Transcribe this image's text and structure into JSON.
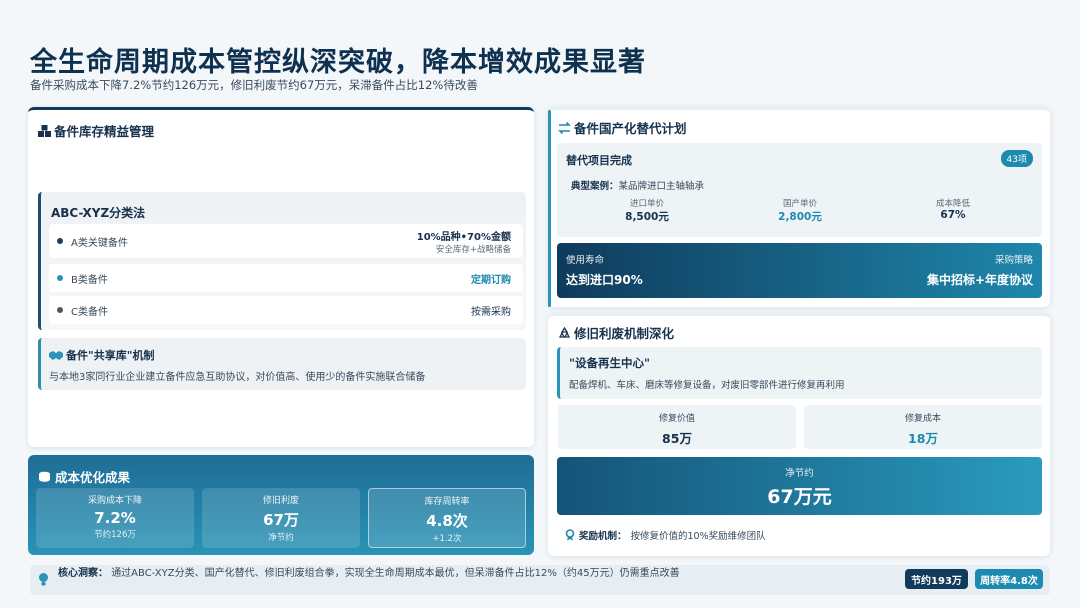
{
  "header": {
    "title": "全生命周期成本管控纵深突破，降本增效成果显著",
    "subtitle": "备件采购成本下降7.2%节约126万元，修旧利废节约67万元，呆滞备件占比12%待改善"
  },
  "inventory": {
    "title": "备件库存精益管理",
    "abc": {
      "title": "ABC-XYZ分类法",
      "rows": [
        {
          "label": "A类关键备件",
          "value": "10%品种•70%金额",
          "note": "安全库存+战略储备",
          "dot_color": "#1f3d5a"
        },
        {
          "label": "B类备件",
          "value": "定期订购",
          "dot_color": "#2a93b6"
        },
        {
          "label": "C类备件",
          "value": "按需采购",
          "dot_color": "#555555"
        }
      ]
    },
    "share": {
      "title": "备件\"共享库\"机制",
      "desc": "与本地3家同行业企业建立备件应急互助协议，对价值高、使用少的备件实施联合储备"
    }
  },
  "cost": {
    "title": "成本优化成果",
    "stats": [
      {
        "label": "采购成本下降",
        "value": "7.2%",
        "sub": "节约126万"
      },
      {
        "label": "修旧利废",
        "value": "67万",
        "sub": "净节约"
      },
      {
        "label": "库存周转率",
        "value": "4.8次",
        "sub": "+1.2次"
      }
    ]
  },
  "localization": {
    "title": "备件国产化替代计划",
    "done_label": "替代项目完成",
    "badge": "43项",
    "case_label": "典型案例：",
    "case_value": "某品牌进口主轴轴承",
    "cols": [
      {
        "label": "进口单价",
        "value": "8,500元"
      },
      {
        "label": "国产单价",
        "value": "2,800元"
      },
      {
        "label": "成本降低",
        "value": "67%"
      }
    ],
    "life_label": "使用寿命",
    "life_value": "达到进口90%",
    "strategy_label": "采购策略",
    "strategy_value": "集中招标+年度协议"
  },
  "repair": {
    "title": "修旧利废机制深化",
    "center_title": "\"设备再生中心\"",
    "center_desc": "配备焊机、车床、磨床等修复设备，对废旧零部件进行修复再利用",
    "value_label": "修复价值",
    "value": "85万",
    "cost_label": "修复成本",
    "cost": "18万",
    "net_label": "净节约",
    "net_value": "67万元",
    "reward_label": "奖励机制：",
    "reward_value": "按修复价值的10%奖励维修团队"
  },
  "insight": {
    "label": "核心洞察：",
    "text": "通过ABC-XYZ分类、国产化替代、修旧利废组合拳，实现全生命周期成本最优，但呆滞备件占比12%（约45万元）仍需重点改善",
    "pill1": "节约193万",
    "pill2": "周转率4.8次"
  },
  "colors": {
    "dark": "#0f3150",
    "accent": "#1d8ab0",
    "teal": "#2a93b6"
  }
}
